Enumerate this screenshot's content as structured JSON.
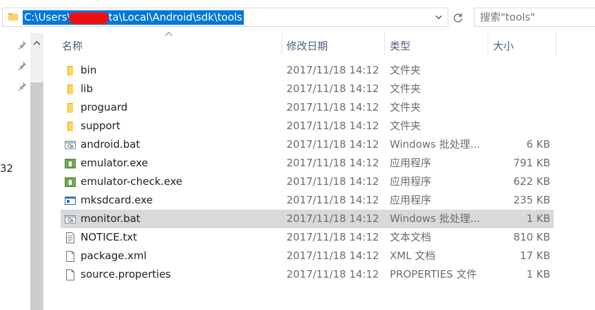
{
  "address": {
    "path": "C:\\Users\\          AppData\\Local\\Android\\sdk\\tools"
  },
  "search": {
    "placeholder": "搜索\"tools\""
  },
  "side": {
    "partial_text": "32"
  },
  "columns": {
    "name": "名称",
    "date": "修改日期",
    "type": "类型",
    "size": "大小"
  },
  "files": [
    {
      "name": "bin",
      "date": "2017/11/18 14:12",
      "type": "文件夹",
      "size": "",
      "icon": "folder-icon"
    },
    {
      "name": "lib",
      "date": "2017/11/18 14:12",
      "type": "文件夹",
      "size": "",
      "icon": "folder-icon"
    },
    {
      "name": "proguard",
      "date": "2017/11/18 14:12",
      "type": "文件夹",
      "size": "",
      "icon": "folder-icon"
    },
    {
      "name": "support",
      "date": "2017/11/18 14:12",
      "type": "文件夹",
      "size": "",
      "icon": "folder-icon"
    },
    {
      "name": "android.bat",
      "date": "2017/11/18 14:12",
      "type": "Windows 批处理...",
      "size": "6 KB",
      "icon": "batch-file-icon"
    },
    {
      "name": "emulator.exe",
      "date": "2017/11/18 14:12",
      "type": "应用程序",
      "size": "791 KB",
      "icon": "emulator-app-icon"
    },
    {
      "name": "emulator-check.exe",
      "date": "2017/11/18 14:12",
      "type": "应用程序",
      "size": "622 KB",
      "icon": "emulator-app-icon"
    },
    {
      "name": "mksdcard.exe",
      "date": "2017/11/18 14:12",
      "type": "应用程序",
      "size": "235 KB",
      "icon": "application-icon"
    },
    {
      "name": "monitor.bat",
      "date": "2017/11/18 14:12",
      "type": "Windows 批处理...",
      "size": "1 KB",
      "icon": "batch-file-icon",
      "selected": true
    },
    {
      "name": "NOTICE.txt",
      "date": "2017/11/18 14:12",
      "type": "文本文档",
      "size": "810 KB",
      "icon": "text-file-icon"
    },
    {
      "name": "package.xml",
      "date": "2017/11/18 14:12",
      "type": "XML 文档",
      "size": "17 KB",
      "icon": "blank-file-icon"
    },
    {
      "name": "source.properties",
      "date": "2017/11/18 14:12",
      "type": "PROPERTIES 文件",
      "size": "1 KB",
      "icon": "blank-file-icon"
    }
  ],
  "colors": {
    "selection": "#0078d7",
    "redaction": "#ee1010",
    "row_selected": "#d9d9d9",
    "header_text": "#4c607a"
  }
}
